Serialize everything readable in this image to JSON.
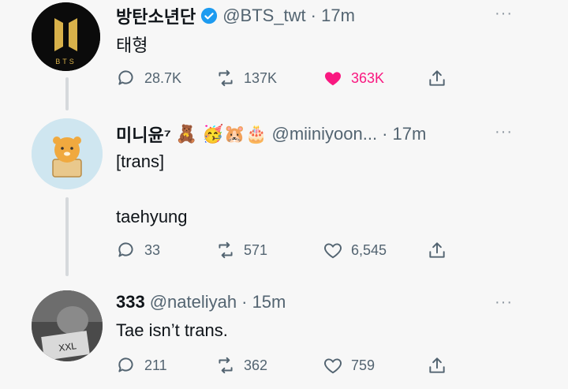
{
  "tweets": [
    {
      "name": "방탄소년단",
      "handle": "@BTS_twt",
      "time": "· 17m",
      "text": "태형",
      "replies": "28.7K",
      "retweets": "137K",
      "likes": "363K",
      "liked": true,
      "avatar_text": "BTS"
    },
    {
      "name": "미니윤⁷",
      "emojis": "🧸 🥳🐹🎂",
      "handle": "@miiniyoon...",
      "time": "· 17m",
      "text_line1": "[trans]",
      "text_line2": "taehyung",
      "replies": "33",
      "retweets": "571",
      "likes": "6,545"
    },
    {
      "name": "333",
      "handle": "@nateliyah",
      "time": "· 15m",
      "text": "Tae isn’t trans.",
      "replies": "211",
      "retweets": "362",
      "likes": "759",
      "avatar_text": "XXL"
    }
  ],
  "more_glyph": "···",
  "colors": {
    "like_active": "#f91880",
    "verified": "#1d9bf0",
    "muted": "#536471"
  }
}
